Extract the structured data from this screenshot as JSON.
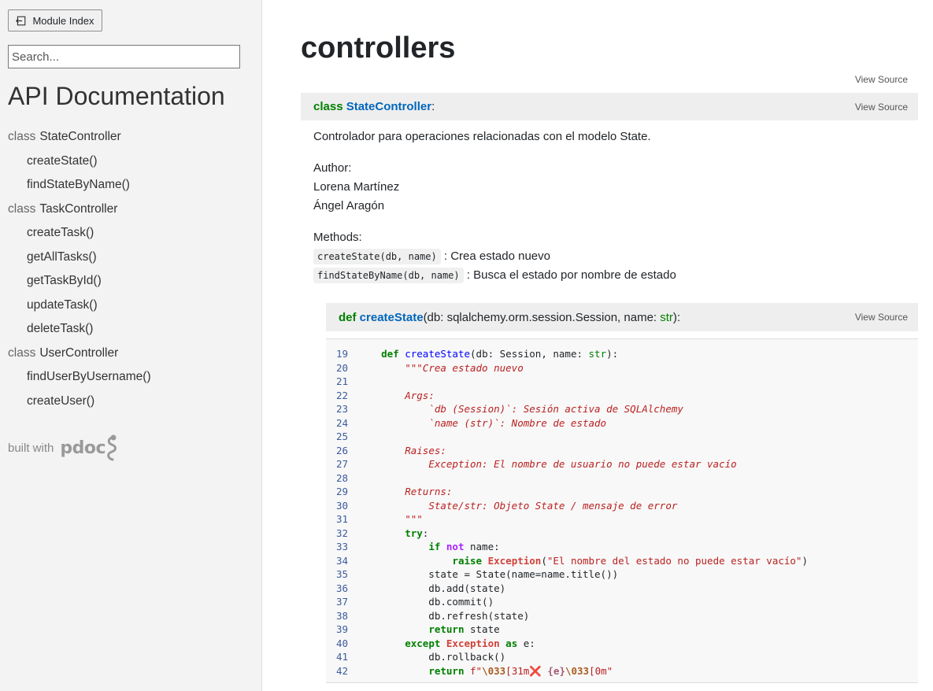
{
  "sidebar": {
    "module_index_label": "Module Index",
    "search_placeholder": "Search...",
    "title": "API Documentation",
    "nav": [
      {
        "kind": "class",
        "kw": "class",
        "name": "StateController"
      },
      {
        "kind": "method",
        "name": "createState()"
      },
      {
        "kind": "method",
        "name": "findStateByName()"
      },
      {
        "kind": "class",
        "kw": "class",
        "name": "TaskController"
      },
      {
        "kind": "method",
        "name": "createTask()"
      },
      {
        "kind": "method",
        "name": "getAllTasks()"
      },
      {
        "kind": "method",
        "name": "getTaskById()"
      },
      {
        "kind": "method",
        "name": "updateTask()"
      },
      {
        "kind": "method",
        "name": "deleteTask()"
      },
      {
        "kind": "class",
        "kw": "class",
        "name": "UserController"
      },
      {
        "kind": "method",
        "name": "findUserByUsername()"
      },
      {
        "kind": "method",
        "name": "createUser()"
      }
    ],
    "built_with": "built with",
    "logo_text": "pdoc"
  },
  "main": {
    "module_name": "controllers",
    "view_source": "View Source",
    "class_block": {
      "keyword": "class",
      "name": "StateController",
      "suffix": ":",
      "description": "Controlador para operaciones relacionadas con el modelo State.",
      "author_label": "Author:",
      "authors": [
        "Lorena Martínez",
        "Ángel Aragón"
      ],
      "methods_label": "Methods:",
      "methods": [
        {
          "code": "createState(db, name)",
          "desc": ": Crea estado nuevo"
        },
        {
          "code": "findStateByName(db, name)",
          "desc": ": Busca el estado por nombre de estado"
        }
      ]
    },
    "function_block": {
      "keyword": "def",
      "name": "createState",
      "sig_open": "(db: sqlalchemy.orm.session.Session, name: ",
      "sig_type": "str",
      "sig_close": "):"
    },
    "code": [
      {
        "n": "19",
        "t": [
          [
            "",
            "    "
          ],
          [
            "kw",
            "def"
          ],
          [
            "",
            " "
          ],
          [
            "fn",
            "createState"
          ],
          [
            "",
            "(db: Session, name: "
          ],
          [
            "bi",
            "str"
          ],
          [
            "",
            "):"
          ]
        ]
      },
      {
        "n": "20",
        "t": [
          [
            "",
            "        "
          ],
          [
            "doc",
            "\"\"\"Crea estado nuevo"
          ]
        ]
      },
      {
        "n": "21",
        "t": []
      },
      {
        "n": "22",
        "t": [
          [
            "",
            "        "
          ],
          [
            "doc",
            "Args:"
          ]
        ]
      },
      {
        "n": "23",
        "t": [
          [
            "",
            "            "
          ],
          [
            "doc",
            "`db (Session)`: Sesión activa de SQLAlchemy"
          ]
        ]
      },
      {
        "n": "24",
        "t": [
          [
            "",
            "            "
          ],
          [
            "doc",
            "`name (str)`: Nombre de estado"
          ]
        ]
      },
      {
        "n": "25",
        "t": []
      },
      {
        "n": "26",
        "t": [
          [
            "",
            "        "
          ],
          [
            "doc",
            "Raises:"
          ]
        ]
      },
      {
        "n": "27",
        "t": [
          [
            "",
            "            "
          ],
          [
            "doc",
            "Exception: El nombre de usuario no puede estar vacío"
          ]
        ]
      },
      {
        "n": "28",
        "t": []
      },
      {
        "n": "29",
        "t": [
          [
            "",
            "        "
          ],
          [
            "doc",
            "Returns:"
          ]
        ]
      },
      {
        "n": "30",
        "t": [
          [
            "",
            "            "
          ],
          [
            "doc",
            "State/str: Objeto State / mensaje de error"
          ]
        ]
      },
      {
        "n": "31",
        "t": [
          [
            "",
            "        "
          ],
          [
            "doc",
            "\"\"\""
          ]
        ]
      },
      {
        "n": "32",
        "t": [
          [
            "",
            "        "
          ],
          [
            "kw",
            "try"
          ],
          [
            "",
            ":"
          ]
        ]
      },
      {
        "n": "33",
        "t": [
          [
            "",
            "            "
          ],
          [
            "kw",
            "if"
          ],
          [
            "",
            " "
          ],
          [
            "not",
            "not"
          ],
          [
            "",
            " name:"
          ]
        ]
      },
      {
        "n": "34",
        "t": [
          [
            "",
            "                "
          ],
          [
            "kw",
            "raise"
          ],
          [
            "",
            " "
          ],
          [
            "exc",
            "Exception"
          ],
          [
            "",
            "("
          ],
          [
            "str",
            "\"El nombre del estado no puede estar vacío\""
          ],
          [
            "",
            ")"
          ]
        ]
      },
      {
        "n": "35",
        "t": [
          [
            "",
            "            state = State(name=name.title())"
          ]
        ]
      },
      {
        "n": "36",
        "t": [
          [
            "",
            "            db.add(state)"
          ]
        ]
      },
      {
        "n": "37",
        "t": [
          [
            "",
            "            db.commit()"
          ]
        ]
      },
      {
        "n": "38",
        "t": [
          [
            "",
            "            db.refresh(state)"
          ]
        ]
      },
      {
        "n": "39",
        "t": [
          [
            "",
            "            "
          ],
          [
            "kw",
            "return"
          ],
          [
            "",
            " state"
          ]
        ]
      },
      {
        "n": "40",
        "t": [
          [
            "",
            "        "
          ],
          [
            "kw",
            "except"
          ],
          [
            "",
            " "
          ],
          [
            "exc",
            "Exception"
          ],
          [
            "",
            " "
          ],
          [
            "kw",
            "as"
          ],
          [
            "",
            " e:"
          ]
        ]
      },
      {
        "n": "41",
        "t": [
          [
            "",
            "            db.rollback()"
          ]
        ]
      },
      {
        "n": "42",
        "t": [
          [
            "",
            "            "
          ],
          [
            "kw",
            "return"
          ],
          [
            "",
            " "
          ],
          [
            "str",
            "f\""
          ],
          [
            "esc",
            "\\033"
          ],
          [
            "str",
            "[31m"
          ],
          [
            "cross",
            "❌"
          ],
          [
            "str",
            " "
          ],
          [
            "int",
            "{e}"
          ],
          [
            "esc",
            "\\033"
          ],
          [
            "str",
            "[0m\""
          ]
        ]
      }
    ]
  }
}
